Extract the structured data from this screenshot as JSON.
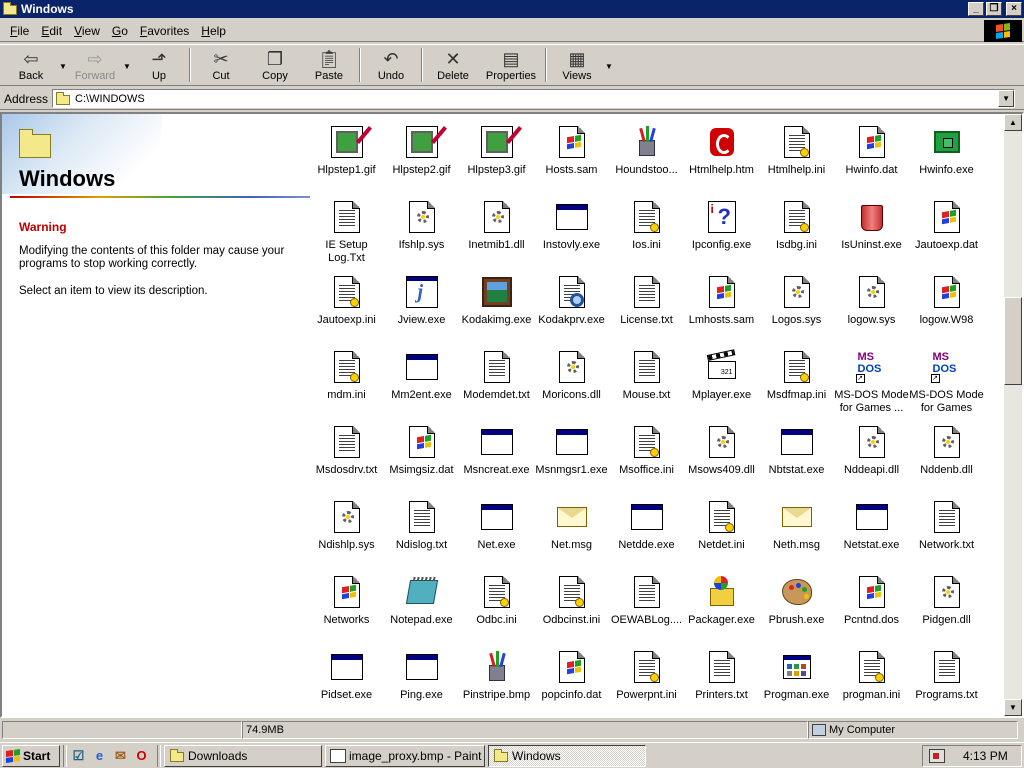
{
  "window": {
    "title": "Windows",
    "buttons": {
      "minimize": "_",
      "maximize": "❐",
      "close": "×"
    }
  },
  "menu": [
    "File",
    "Edit",
    "View",
    "Go",
    "Favorites",
    "Help"
  ],
  "toolbar": {
    "back": "Back",
    "forward": "Forward",
    "up": "Up",
    "cut": "Cut",
    "copy": "Copy",
    "paste": "Paste",
    "undo": "Undo",
    "delete": "Delete",
    "properties": "Properties",
    "views": "Views"
  },
  "address": {
    "label": "Address",
    "value": "C:\\WINDOWS"
  },
  "leftpane": {
    "title": "Windows",
    "warning_heading": "Warning",
    "warning_text": "Modifying the contents of this folder may cause your programs to stop working correctly.",
    "hint": "Select an item to view its description."
  },
  "files": [
    {
      "name": "Hlpstep1.gif",
      "icon": "picture-icon"
    },
    {
      "name": "Hlpstep2.gif",
      "icon": "picture-icon"
    },
    {
      "name": "Hlpstep3.gif",
      "icon": "picture-icon"
    },
    {
      "name": "Hosts.sam",
      "icon": "windows-doc-icon"
    },
    {
      "name": "Houndstoo...",
      "icon": "pencils-icon"
    },
    {
      "name": "Htmlhelp.htm",
      "icon": "html-help-icon"
    },
    {
      "name": "Htmlhelp.ini",
      "icon": "ini-icon"
    },
    {
      "name": "Hwinfo.dat",
      "icon": "windows-doc-icon"
    },
    {
      "name": "Hwinfo.exe",
      "icon": "chip-icon"
    },
    {
      "name": "IE Setup Log.Txt",
      "icon": "text-icon"
    },
    {
      "name": "Ifshlp.sys",
      "icon": "sys-icon"
    },
    {
      "name": "Inetmib1.dll",
      "icon": "dll-icon"
    },
    {
      "name": "Instovly.exe",
      "icon": "exe-icon"
    },
    {
      "name": "Ios.ini",
      "icon": "ini-icon"
    },
    {
      "name": "Ipconfig.exe",
      "icon": "help-icon"
    },
    {
      "name": "Isdbg.ini",
      "icon": "ini-icon"
    },
    {
      "name": "IsUninst.exe",
      "icon": "bucket-icon"
    },
    {
      "name": "Jautoexp.dat",
      "icon": "windows-doc-icon"
    },
    {
      "name": "Jautoexp.ini",
      "icon": "ini-icon"
    },
    {
      "name": "Jview.exe",
      "icon": "java-icon"
    },
    {
      "name": "Kodakimg.exe",
      "icon": "gallery-icon"
    },
    {
      "name": "Kodakprv.exe",
      "icon": "kodak-preview-icon"
    },
    {
      "name": "License.txt",
      "icon": "text-icon"
    },
    {
      "name": "Lmhosts.sam",
      "icon": "windows-doc-icon"
    },
    {
      "name": "Logos.sys",
      "icon": "sys-icon"
    },
    {
      "name": "logow.sys",
      "icon": "sys-icon"
    },
    {
      "name": "logow.W98",
      "icon": "windows-doc-icon"
    },
    {
      "name": "mdm.ini",
      "icon": "ini-icon"
    },
    {
      "name": "Mm2ent.exe",
      "icon": "exe-icon"
    },
    {
      "name": "Modemdet.txt",
      "icon": "text-icon"
    },
    {
      "name": "Moricons.dll",
      "icon": "dll-icon"
    },
    {
      "name": "Mouse.txt",
      "icon": "text-icon"
    },
    {
      "name": "Mplayer.exe",
      "icon": "clapper-icon"
    },
    {
      "name": "Msdfmap.ini",
      "icon": "ini-icon"
    },
    {
      "name": "MS-DOS Mode for Games ...",
      "icon": "msdos-icon"
    },
    {
      "name": "MS-DOS Mode for Games",
      "icon": "msdos-icon"
    },
    {
      "name": "Msdosdrv.txt",
      "icon": "text-icon"
    },
    {
      "name": "Msimgsiz.dat",
      "icon": "windows-doc-icon"
    },
    {
      "name": "Msncreat.exe",
      "icon": "exe-icon"
    },
    {
      "name": "Msnmgsr1.exe",
      "icon": "exe-icon"
    },
    {
      "name": "Msoffice.ini",
      "icon": "ini-icon"
    },
    {
      "name": "Msows409.dll",
      "icon": "dll-icon"
    },
    {
      "name": "Nbtstat.exe",
      "icon": "exe-icon"
    },
    {
      "name": "Nddeapi.dll",
      "icon": "dll-icon"
    },
    {
      "name": "Nddenb.dll",
      "icon": "dll-icon"
    },
    {
      "name": "Ndishlp.sys",
      "icon": "sys-icon"
    },
    {
      "name": "Ndislog.txt",
      "icon": "text-icon"
    },
    {
      "name": "Net.exe",
      "icon": "exe-icon"
    },
    {
      "name": "Net.msg",
      "icon": "envelope-icon"
    },
    {
      "name": "Netdde.exe",
      "icon": "exe-icon"
    },
    {
      "name": "Netdet.ini",
      "icon": "ini-icon"
    },
    {
      "name": "Neth.msg",
      "icon": "envelope-icon"
    },
    {
      "name": "Netstat.exe",
      "icon": "exe-icon"
    },
    {
      "name": "Network.txt",
      "icon": "text-icon"
    },
    {
      "name": "Networks",
      "icon": "windows-doc-icon"
    },
    {
      "name": "Notepad.exe",
      "icon": "notepad-icon"
    },
    {
      "name": "Odbc.ini",
      "icon": "ini-icon"
    },
    {
      "name": "Odbcinst.ini",
      "icon": "ini-icon"
    },
    {
      "name": "OEWABLog....",
      "icon": "text-icon"
    },
    {
      "name": "Packager.exe",
      "icon": "package-icon"
    },
    {
      "name": "Pbrush.exe",
      "icon": "palette-icon"
    },
    {
      "name": "Pcntnd.dos",
      "icon": "windows-doc-icon"
    },
    {
      "name": "Pidgen.dll",
      "icon": "dll-icon"
    },
    {
      "name": "Pidset.exe",
      "icon": "exe-icon"
    },
    {
      "name": "Ping.exe",
      "icon": "exe-icon"
    },
    {
      "name": "Pinstripe.bmp",
      "icon": "pencils-icon"
    },
    {
      "name": "popcinfo.dat",
      "icon": "windows-doc-icon"
    },
    {
      "name": "Powerpnt.ini",
      "icon": "ini-icon"
    },
    {
      "name": "Printers.txt",
      "icon": "text-icon"
    },
    {
      "name": "Progman.exe",
      "icon": "progman-icon"
    },
    {
      "name": "progman.ini",
      "icon": "ini-icon"
    },
    {
      "name": "Programs.txt",
      "icon": "text-icon"
    }
  ],
  "status": {
    "size": "74.9MB",
    "zone": "My Computer"
  },
  "taskbar": {
    "start": "Start",
    "tasks": [
      {
        "label": "Downloads",
        "active": false
      },
      {
        "label": "image_proxy.bmp - Paint",
        "active": false
      },
      {
        "label": "Windows",
        "active": true
      }
    ],
    "clock": "4:13 PM"
  }
}
